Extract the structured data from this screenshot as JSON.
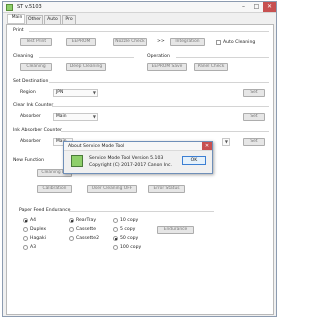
{
  "window": {
    "title": "ST v.5103",
    "min": "–",
    "max": "□",
    "close": "✕"
  },
  "tabs": [
    "Main",
    "Other",
    "Auto",
    "Pro"
  ],
  "print": {
    "title": "Print",
    "test_print": "Test Print",
    "eeprom": "EEPROM",
    "nozzle_check": "Nozzle Check",
    "arrow": ">>",
    "integration": "Integration",
    "auto_cleaning": "Auto Cleaning"
  },
  "cleaning": {
    "title": "Cleaning",
    "cleaning": "Cleaning",
    "deep_cleaning": "Deep Cleaning"
  },
  "operation": {
    "title": "Operation",
    "eeprom_save": "EEPROM Save",
    "panel_check": "Panel Check"
  },
  "set_destination": {
    "title": "Set Destination",
    "region_label": "Region",
    "region_value": "JPN",
    "set": "Set"
  },
  "clear_ink": {
    "title": "Clear Ink Counter",
    "absorber_label": "Absorber",
    "absorber_value": "Main",
    "set": "Set"
  },
  "ink_absorber": {
    "title": "Ink Absorber Counter",
    "absorber_label": "Absorber",
    "absorber_value": "Main",
    "set": "Set"
  },
  "new_function": {
    "title": "New Function",
    "cleaning_bk": "Cleaning Bk",
    "calibration": "Calibration",
    "user_cleaning_off": "User Cleaning OFF",
    "error_status": "Error Status"
  },
  "paper_feed": {
    "title": "Paper Feed Endurance",
    "col1": [
      "A4",
      "Duplex",
      "Hagaki",
      "A3"
    ],
    "col2": [
      "RearTray",
      "Cassette",
      "Cassette2"
    ],
    "col3": [
      "10 copy",
      "5 copy",
      "50 copy",
      "100 copy"
    ],
    "endurance": "Endurance",
    "selected_size": "A4",
    "selected_tray": "RearTray",
    "selected_copy": "50 copy"
  },
  "dialog": {
    "title": "About Service Mode Tool",
    "line1": "Service Mode Tool  Version 5.103",
    "line2": "Copyright (C) 2017-2017 Canon Inc.",
    "ok": "OK",
    "close": "✕"
  },
  "colors": {
    "accent": "#3c7fd3",
    "close": "#c75050"
  }
}
